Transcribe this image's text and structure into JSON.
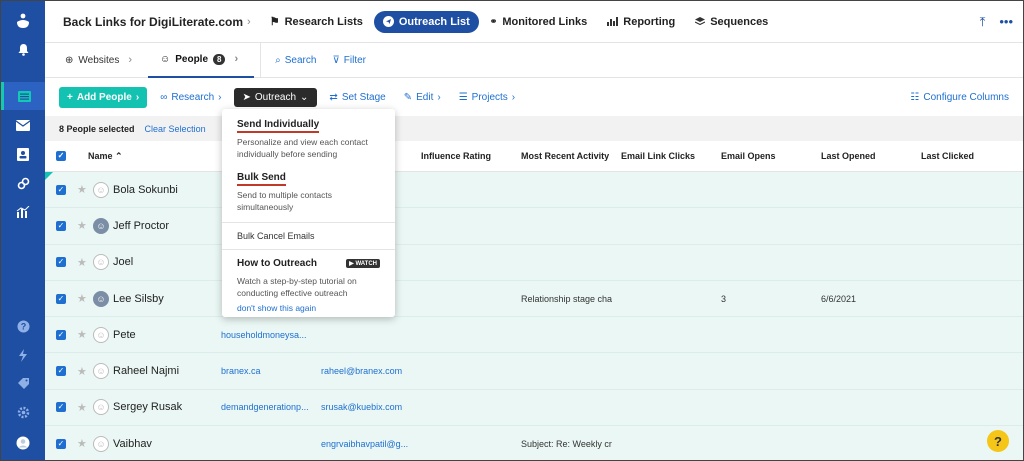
{
  "app": {
    "title": "Back Links for DigiLiterate.com"
  },
  "topnav": [
    {
      "label": "Research Lists",
      "icon": "flag-icon"
    },
    {
      "label": "Outreach List",
      "icon": "send-icon",
      "active": true
    },
    {
      "label": "Monitored Links",
      "icon": "link-icon"
    },
    {
      "label": "Reporting",
      "icon": "bar-chart-icon"
    },
    {
      "label": "Sequences",
      "icon": "layers-icon"
    }
  ],
  "subtabs": {
    "websites": "Websites",
    "people": "People",
    "people_count": "8",
    "search": "Search",
    "filter": "Filter"
  },
  "toolbar": {
    "add_people": "Add People",
    "research": "Research",
    "outreach": "Outreach",
    "set_stage": "Set Stage",
    "edit": "Edit",
    "projects": "Projects",
    "configure": "Configure Columns"
  },
  "selection": {
    "count_text": "8 People selected",
    "clear": "Clear Selection"
  },
  "columns": {
    "name": "Name",
    "influence": "Influence Rating",
    "activity": "Most Recent Activity",
    "link_clicks": "Email Link Clicks",
    "opens": "Email Opens",
    "last_opened": "Last Opened",
    "last_clicked": "Last Clicked"
  },
  "rows": [
    {
      "name": "Bola Sokunbi",
      "site": "",
      "email": "...n...",
      "activity": "",
      "opens": "",
      "last_opened": "",
      "photo": false
    },
    {
      "name": "Jeff Proctor",
      "site": "",
      "email": "...m",
      "activity": "",
      "opens": "",
      "last_opened": "",
      "photo": true
    },
    {
      "name": "Joel",
      "site": "",
      "email": "...e...",
      "activity": "",
      "opens": "",
      "last_opened": "",
      "photo": false
    },
    {
      "name": "Lee Silsby",
      "site": "",
      "email": "...l...",
      "activity": "Relationship stage cha",
      "opens": "3",
      "last_opened": "6/6/2021",
      "photo": true
    },
    {
      "name": "Pete",
      "site": "householdmoneysa...",
      "email": "",
      "activity": "",
      "opens": "",
      "last_opened": "",
      "photo": false
    },
    {
      "name": "Raheel Najmi",
      "site": "branex.ca",
      "email": "raheel@branex.com",
      "activity": "",
      "opens": "",
      "last_opened": "",
      "photo": false
    },
    {
      "name": "Sergey Rusak",
      "site": "demandgenerationp...",
      "email": "srusak@kuebix.com",
      "activity": "",
      "opens": "",
      "last_opened": "",
      "photo": false
    },
    {
      "name": "Vaibhav",
      "site": "",
      "email": "engrvaibhavpatil@g...",
      "activity": "Subject: Re: Weekly cr",
      "opens": "",
      "last_opened": "",
      "photo": false
    }
  ],
  "dropdown": {
    "send_individually": {
      "title": "Send Individually",
      "desc": "Personalize and view each contact individually before sending"
    },
    "bulk_send": {
      "title": "Bulk Send",
      "desc": "Send to multiple contacts simultaneously"
    },
    "bulk_cancel": "Bulk Cancel Emails",
    "how_to": {
      "title": "How to Outreach",
      "badge": "WATCH",
      "desc": "Watch a step-by-step tutorial on conducting effective outreach",
      "link": "don't show this again"
    }
  },
  "colors": {
    "sidebar": "#1f4fa3",
    "accent": "#13c2b0",
    "link": "#1f6fd1",
    "row_selected": "#eaf7f4"
  }
}
